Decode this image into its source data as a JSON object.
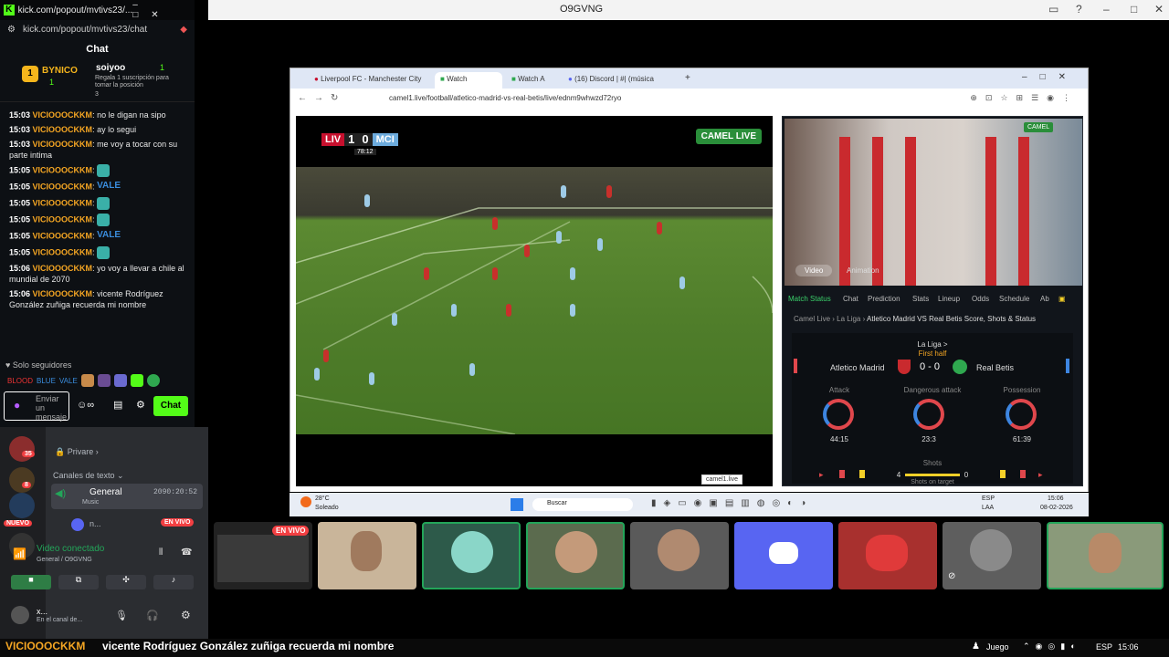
{
  "outer_window": {
    "title": "O9GVNG"
  },
  "kick": {
    "window_url": "kick.com/popout/mvtivs23/...",
    "page_url": "kick.com/popout/mvtivs23/chat",
    "chat_title": "Chat",
    "pinned": {
      "rank_user": "BYNICO",
      "rank_count": "1",
      "rank_pos": "1",
      "user": "soiyoo",
      "user_count": "1",
      "text": "Regala 1 suscripción para tomar la posición",
      "pos": "3"
    },
    "messages": [
      {
        "time": "15:03",
        "user": "VICIOOOCKKM",
        "text": ": no le digan na sipo"
      },
      {
        "time": "15:03",
        "user": "VICIOOOCKKM",
        "text": ": ay lo segui"
      },
      {
        "time": "15:03",
        "user": "VICIOOOCKKM",
        "text": ": me voy a tocar con su parte intima"
      },
      {
        "time": "15:05",
        "user": "VICIOOOCKKM",
        "text": ":",
        "emote": "teal"
      },
      {
        "time": "15:05",
        "user": "VICIOOOCKKM",
        "text": ":",
        "emote": "VALE"
      },
      {
        "time": "15:05",
        "user": "VICIOOOCKKM",
        "text": ":",
        "emote": "teal"
      },
      {
        "time": "15:05",
        "user": "VICIOOOCKKM",
        "text": ":",
        "emote": "teal"
      },
      {
        "time": "15:05",
        "user": "VICIOOOCKKM",
        "text": ":",
        "emote": "VALE"
      },
      {
        "time": "15:05",
        "user": "VICIOOOCKKM",
        "text": ":",
        "emote": "teal"
      },
      {
        "time": "15:06",
        "user": "VICIOOOCKKM",
        "text": ": yo voy a llevar a chile al mundial de 2070"
      },
      {
        "time": "15:06",
        "user": "VICIOOOCKKM",
        "text": ": vicente Rodríguez González zuñiga recuerda mi nombre"
      }
    ],
    "followers_only": "Solo seguidores",
    "emote_labels": [
      "BLOOD",
      "BLUE",
      "VALE"
    ],
    "input_placeholder": "Enviar un mensaje",
    "chat_button": "Chat"
  },
  "discord": {
    "server_badges": [
      "35",
      "8"
    ],
    "new_label": "NUEVO",
    "private_label": "Privare",
    "category": "Canales de texto",
    "channel_name": "General",
    "channel_timer": "2090:20:52",
    "channel_sub": "Music",
    "user_n": "n...",
    "live_badge": "EN VIVO",
    "voice_status": "Video conectado",
    "voice_channel": "General / O9GVNG",
    "user_name": "x...",
    "user_status": "En el canal de..."
  },
  "browser": {
    "tabs": [
      "Liverpool FC - Manchester City",
      "Watch",
      "Watch A",
      "(16) Discord | #| (música"
    ],
    "url": "camel1.live/football/atletico-madrid-vs-real-betis/live/ednm9whwzd72ryo"
  },
  "video": {
    "home": "LIV",
    "away": "MCI",
    "score_home": "1",
    "score_away": "0",
    "clock": "78:12",
    "brand": "CAMEL LIVE"
  },
  "side": {
    "video_tab": "Video",
    "animation_tab": "Animation",
    "nav": [
      "Match Status",
      "Chat",
      "Prediction",
      "Stats",
      "Lineup",
      "Odds",
      "Schedule",
      "Ab"
    ],
    "crumbs": [
      "Camel Live",
      "La Liga",
      "Atletico Madrid VS Real Betis Score, Shots & Status"
    ],
    "league": "La Liga >",
    "period": "First half",
    "home": "Atletico Madrid",
    "away": "Real Betis",
    "score": "0 - 0",
    "stats": [
      {
        "label": "Attack",
        "value": "44:15"
      },
      {
        "label": "Dangerous attack",
        "value": "23:3"
      },
      {
        "label": "Possession",
        "value": "61:39"
      }
    ],
    "shots_label": "Shots",
    "shots_home": "4",
    "shots_away": "0",
    "shots_target": "Shots on target",
    "brand_small": "CAMEL",
    "footer_tag": "camel1.live"
  },
  "inner_taskbar": {
    "temp": "28°C",
    "weather": "Soleado",
    "search": "Buscar",
    "lang": "ESP",
    "region": "LAA",
    "time": "15:06",
    "date": "08-02-2026"
  },
  "tiles": {
    "live_badge": "EN VIVO"
  },
  "bottom": {
    "user": "VICIOOOCKKM",
    "text": "vicente Rodríguez González zuñiga recuerda mi nombre",
    "game": "Juego",
    "lang": "ESP",
    "time": "15:06"
  }
}
